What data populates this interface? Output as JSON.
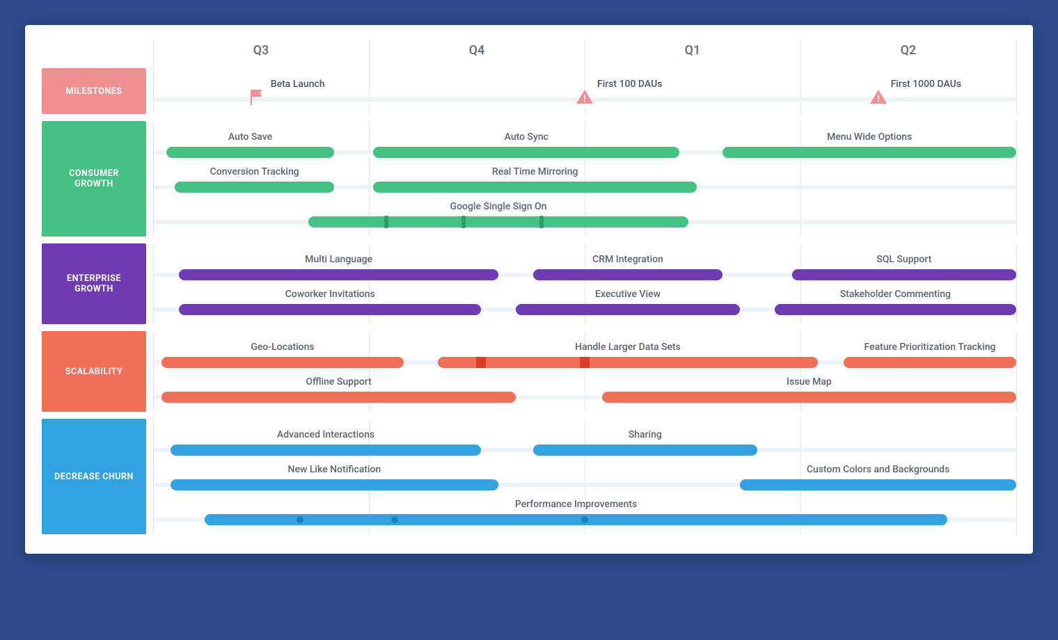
{
  "colors": {
    "pink": "#f08f92",
    "green": "#45c181",
    "purple": "#6f3bb2",
    "orange": "#ef6f58",
    "blue": "#31a2e2",
    "tickGreen": "#2e9e64",
    "sqRed": "#d83f2a",
    "dotBlue": "#1a7fbf"
  },
  "quarters": [
    "Q3",
    "Q4",
    "Q1",
    "Q2"
  ],
  "milestones": [
    {
      "label": "Beta Launch",
      "icon": "flag",
      "x": 12,
      "textOffset": 20
    },
    {
      "label": "First 100 DAUs",
      "icon": "warn",
      "x": 50,
      "textOffset": 18
    },
    {
      "label": "First 1000 DAUs",
      "icon": "warn",
      "x": 84,
      "textOffset": 18
    }
  ],
  "lanes": [
    {
      "name": "MILESTONES",
      "colorKey": "pink",
      "rows": [
        {
          "type": "milestones"
        }
      ]
    },
    {
      "name": "CONSUMER GROWTH",
      "colorKey": "green",
      "rows": [
        {
          "bars": [
            {
              "label": "Auto Save",
              "start": 1.5,
              "end": 21
            },
            {
              "label": "Auto Sync",
              "start": 25.5,
              "end": 61
            },
            {
              "label": "Menu Wide Options",
              "start": 66,
              "end": 100
            }
          ]
        },
        {
          "bars": [
            {
              "label": "Conversion Tracking",
              "start": 2.5,
              "end": 21
            },
            {
              "label": "Real Time Mirroring",
              "start": 25.5,
              "end": 63
            }
          ]
        },
        {
          "bars": [
            {
              "label": "Google Single Sign On",
              "start": 18,
              "end": 62,
              "ticks": [
                27,
                36,
                45
              ],
              "tickColorKey": "tickGreen"
            }
          ]
        }
      ]
    },
    {
      "name": "ENTERPRISE GROWTH",
      "colorKey": "purple",
      "rows": [
        {
          "bars": [
            {
              "label": "Multi Language",
              "start": 3,
              "end": 40
            },
            {
              "label": "CRM Integration",
              "start": 44,
              "end": 66
            },
            {
              "label": "SQL Support",
              "start": 74,
              "end": 100
            }
          ]
        },
        {
          "bars": [
            {
              "label": "Coworker Invitations",
              "start": 3,
              "end": 38
            },
            {
              "label": "Executive View",
              "start": 42,
              "end": 68
            },
            {
              "label": "Stakeholder Commenting",
              "start": 72,
              "end": 100
            }
          ]
        }
      ]
    },
    {
      "name": "SCALABILITY",
      "colorKey": "orange",
      "rows": [
        {
          "bars": [
            {
              "label": "Geo-Locations",
              "start": 1,
              "end": 29
            },
            {
              "label": "Handle Larger Data Sets",
              "start": 33,
              "end": 77,
              "squares": [
                38,
                50
              ],
              "sqColorKey": "sqRed"
            },
            {
              "label": "Feature Prioritization Tracking",
              "start": 80,
              "end": 100
            }
          ]
        },
        {
          "bars": [
            {
              "label": "Offline Support",
              "start": 1,
              "end": 42
            },
            {
              "label": "Issue Map",
              "start": 52,
              "end": 100
            }
          ]
        }
      ]
    },
    {
      "name": "DECREASE CHURN",
      "colorKey": "blue",
      "rows": [
        {
          "bars": [
            {
              "label": "Advanced Interactions",
              "start": 2,
              "end": 38
            },
            {
              "label": "Sharing",
              "start": 44,
              "end": 70
            }
          ]
        },
        {
          "bars": [
            {
              "label": "New Like Notification",
              "start": 2,
              "end": 40
            },
            {
              "label": "Custom Colors and Backgrounds",
              "start": 68,
              "end": 100
            }
          ]
        },
        {
          "bars": [
            {
              "label": "Performance Improvements",
              "start": 6,
              "end": 92,
              "dots": [
                17,
                28,
                50
              ],
              "dotColorKey": "dotBlue"
            }
          ]
        }
      ]
    }
  ],
  "chart_data": {
    "type": "bar",
    "x_axis": {
      "label": "Quarter",
      "ticks": [
        "Q3",
        "Q4",
        "Q1",
        "Q2"
      ],
      "range_pct": [
        0,
        100
      ]
    },
    "note": "start/end are % of the 4-quarter horizontal span (0 = start of Q3, 100 = end of Q2).",
    "milestones": [
      {
        "label": "Beta Launch",
        "pct": 12
      },
      {
        "label": "First 100 DAUs",
        "pct": 50
      },
      {
        "label": "First 1000 DAUs",
        "pct": 84
      }
    ],
    "swimlanes": [
      {
        "name": "CONSUMER GROWTH",
        "color": "#45c181",
        "tasks": [
          {
            "name": "Auto Save",
            "start": 1.5,
            "end": 21
          },
          {
            "name": "Auto Sync",
            "start": 25.5,
            "end": 61
          },
          {
            "name": "Menu Wide Options",
            "start": 66,
            "end": 100
          },
          {
            "name": "Conversion Tracking",
            "start": 2.5,
            "end": 21
          },
          {
            "name": "Real Time Mirroring",
            "start": 25.5,
            "end": 63
          },
          {
            "name": "Google Single Sign On",
            "start": 18,
            "end": 62,
            "markers_pct": [
              27,
              36,
              45
            ]
          }
        ]
      },
      {
        "name": "ENTERPRISE GROWTH",
        "color": "#6f3bb2",
        "tasks": [
          {
            "name": "Multi Language",
            "start": 3,
            "end": 40
          },
          {
            "name": "CRM Integration",
            "start": 44,
            "end": 66
          },
          {
            "name": "SQL Support",
            "start": 74,
            "end": 100
          },
          {
            "name": "Coworker Invitations",
            "start": 3,
            "end": 38
          },
          {
            "name": "Executive View",
            "start": 42,
            "end": 68
          },
          {
            "name": "Stakeholder Commenting",
            "start": 72,
            "end": 100
          }
        ]
      },
      {
        "name": "SCALABILITY",
        "color": "#ef6f58",
        "tasks": [
          {
            "name": "Geo-Locations",
            "start": 1,
            "end": 29
          },
          {
            "name": "Handle Larger Data Sets",
            "start": 33,
            "end": 77,
            "markers_pct": [
              38,
              50
            ]
          },
          {
            "name": "Feature Prioritization Tracking",
            "start": 80,
            "end": 100
          },
          {
            "name": "Offline Support",
            "start": 1,
            "end": 42
          },
          {
            "name": "Issue Map",
            "start": 52,
            "end": 100
          }
        ]
      },
      {
        "name": "DECREASE CHURN",
        "color": "#31a2e2",
        "tasks": [
          {
            "name": "Advanced Interactions",
            "start": 2,
            "end": 38
          },
          {
            "name": "Sharing",
            "start": 44,
            "end": 70
          },
          {
            "name": "New Like Notification",
            "start": 2,
            "end": 40
          },
          {
            "name": "Custom Colors and Backgrounds",
            "start": 68,
            "end": 100
          },
          {
            "name": "Performance Improvements",
            "start": 6,
            "end": 92,
            "markers_pct": [
              17,
              28,
              50
            ]
          }
        ]
      }
    ]
  }
}
